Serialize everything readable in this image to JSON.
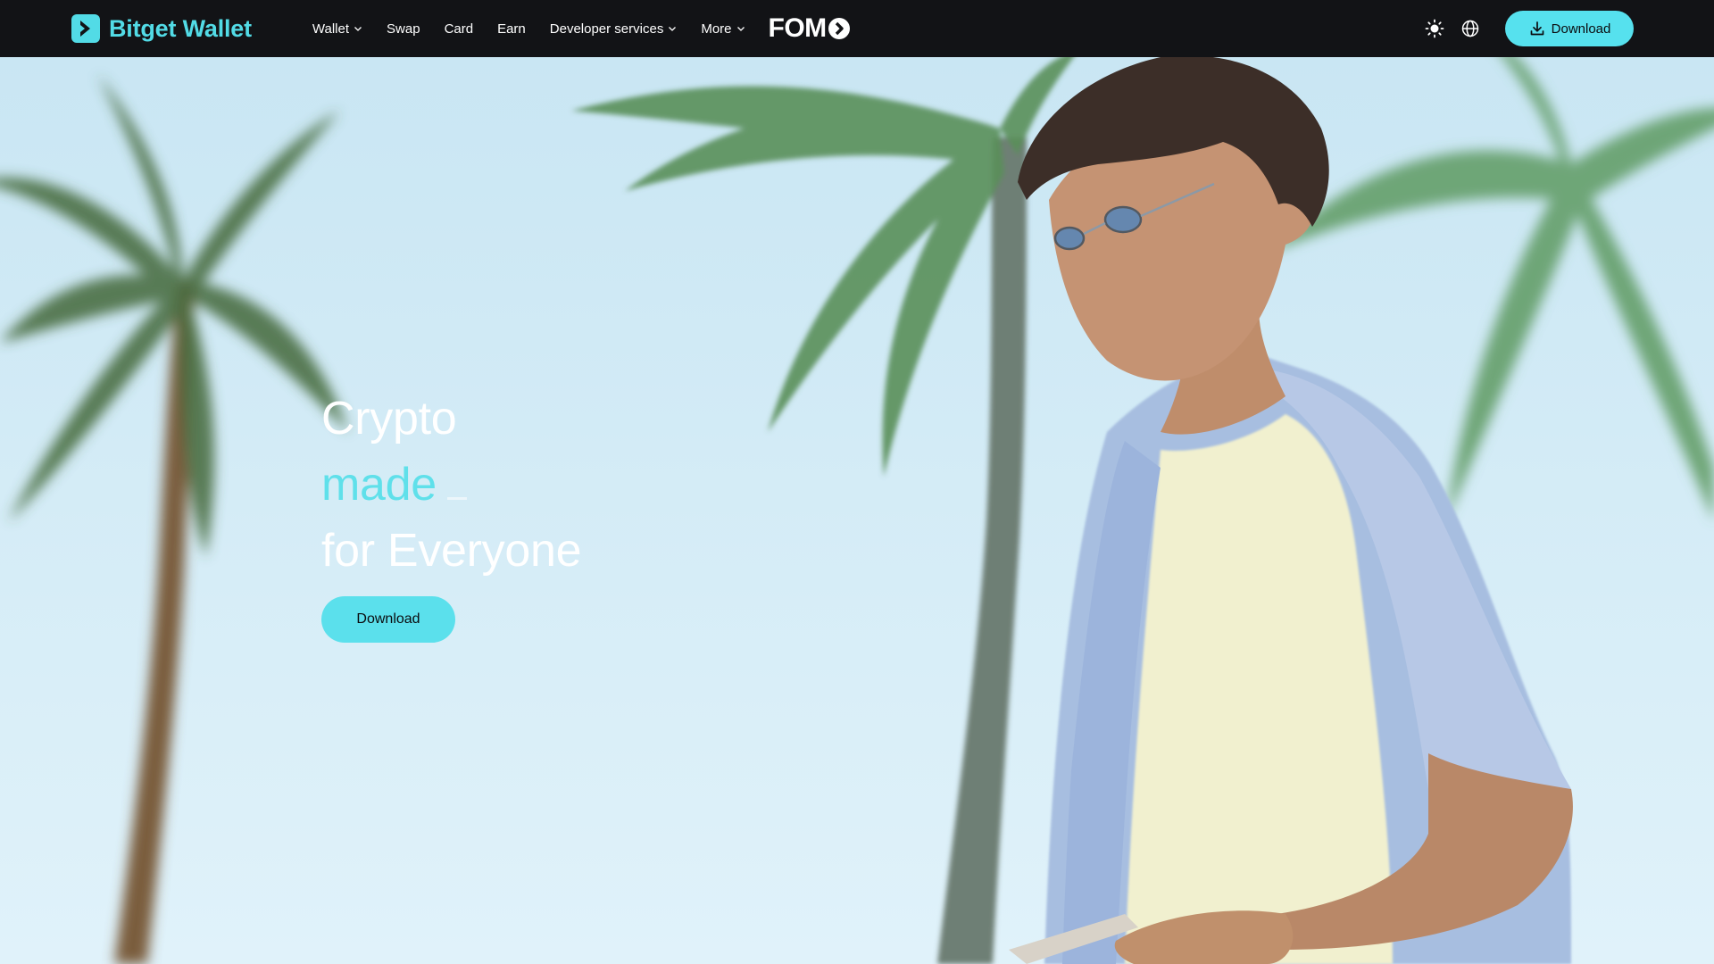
{
  "brand": {
    "name": "Bitget Wallet",
    "logo_icon": "bitget-logo-icon"
  },
  "nav": {
    "items": [
      {
        "label": "Wallet",
        "has_dropdown": true
      },
      {
        "label": "Swap",
        "has_dropdown": false
      },
      {
        "label": "Card",
        "has_dropdown": false
      },
      {
        "label": "Earn",
        "has_dropdown": false
      },
      {
        "label": "Developer services",
        "has_dropdown": true
      },
      {
        "label": "More",
        "has_dropdown": true
      }
    ],
    "fomo": {
      "label": "FOM",
      "badge_icon": "arrow-circle-icon"
    }
  },
  "header_tools": {
    "theme_icon": "sun-icon",
    "language_icon": "globe-icon",
    "download_label": "Download",
    "download_icon": "download-icon"
  },
  "hero": {
    "line1": "Crypto",
    "line2": "made",
    "line3": "for Everyone",
    "cta_label": "Download",
    "background": "photo-man-with-phone-under-palm-trees"
  },
  "colors": {
    "accent": "#56e1ee",
    "header_bg": "#121316",
    "brand_text": "#52dbe6",
    "sky": "#d6ecf7"
  }
}
